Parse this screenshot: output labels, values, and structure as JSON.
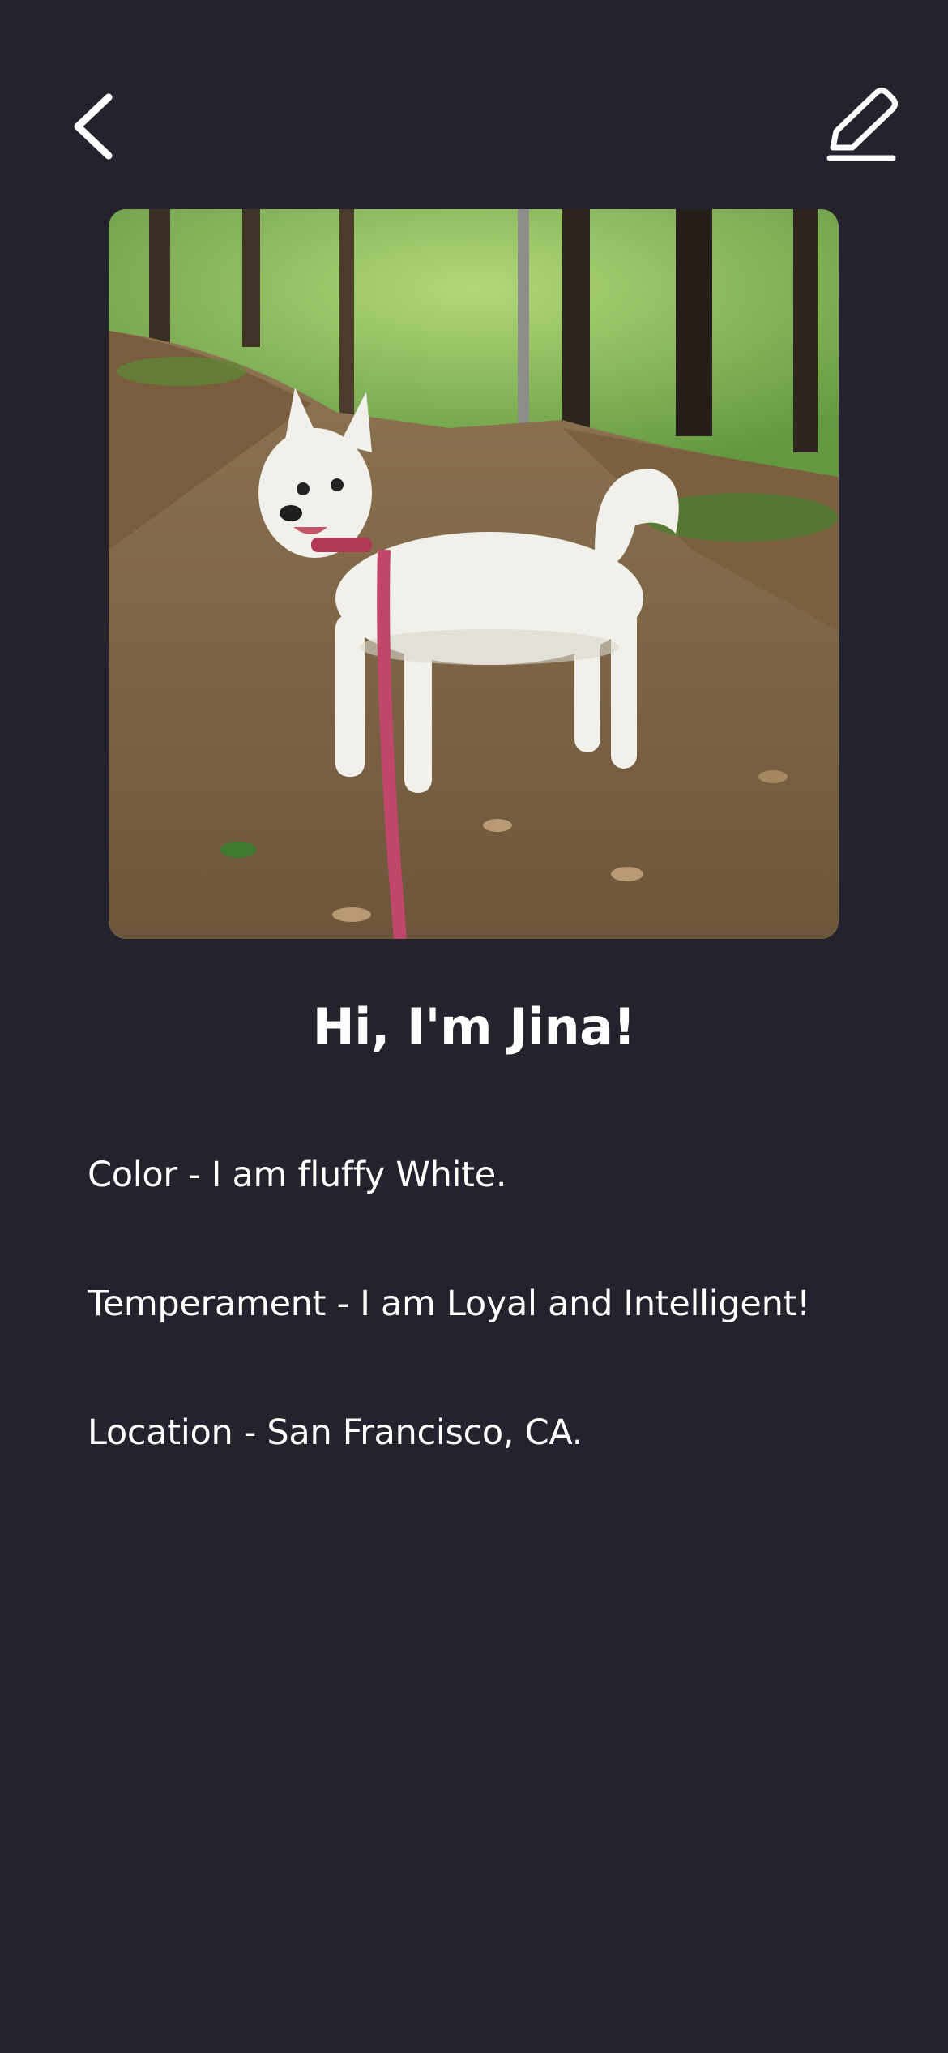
{
  "header": {
    "back_icon": "chevron-left-icon",
    "edit_icon": "pencil-icon"
  },
  "profile": {
    "photo_description": "White dog on a leash standing on a forest trail",
    "title": "Hi, I'm Jina!",
    "details": [
      "Color - I am fluffy White.",
      "Temperament - I am Loyal and Intelligent!",
      "Location - San Francisco, CA."
    ]
  },
  "colors": {
    "background": "#24222d",
    "text": "#ffffff"
  }
}
